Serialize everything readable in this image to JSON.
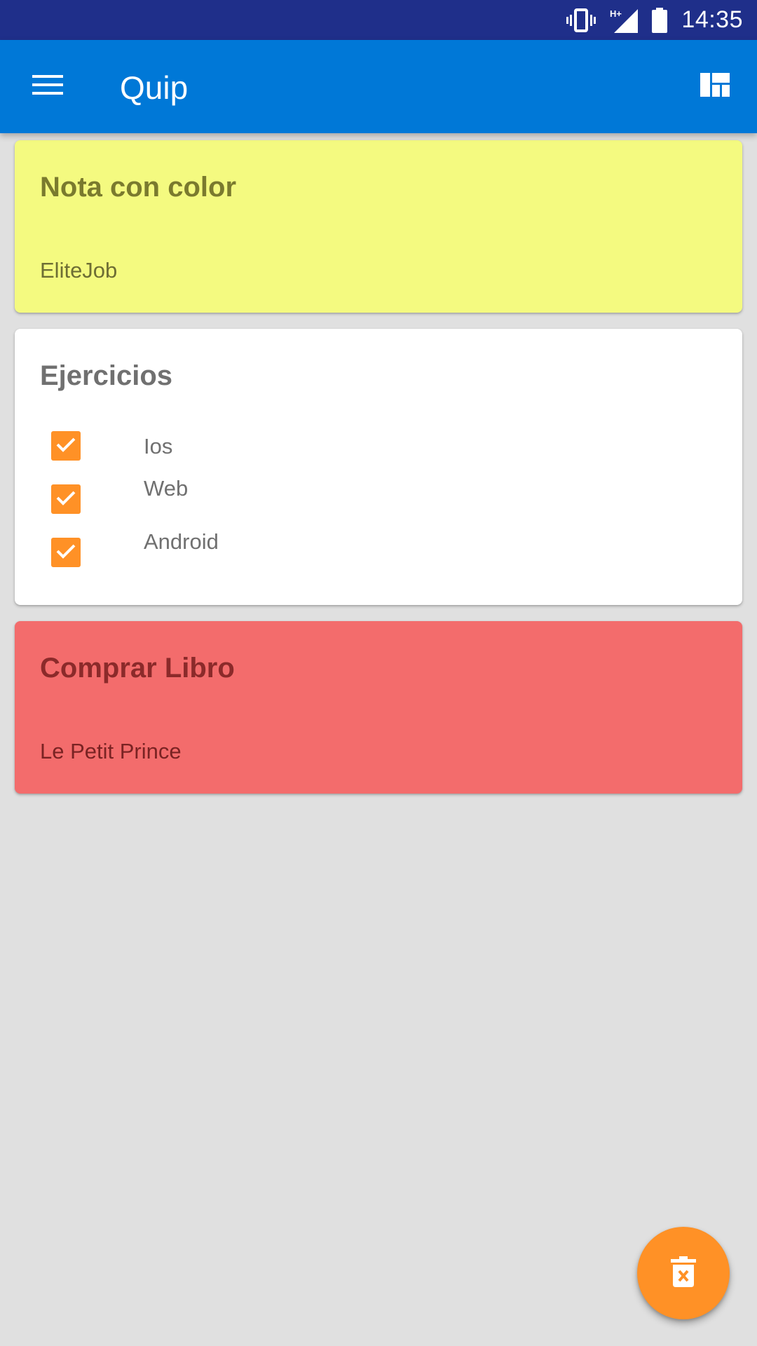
{
  "status_bar": {
    "time": "14:35",
    "icons": [
      "vibrate-icon",
      "signal-hplus-icon",
      "battery-icon"
    ],
    "network_label": "H+"
  },
  "app_bar": {
    "title": "Quip",
    "left_icon": "menu-icon",
    "right_icon": "layout-toggle-icon"
  },
  "notes": [
    {
      "title": "Nota con color",
      "body": "EliteJob",
      "color": "#f4fa80"
    },
    {
      "title": "Ejercicios",
      "color": "#ffffff",
      "checklist": [
        {
          "label": "Ios",
          "checked": true
        },
        {
          "label": "Web",
          "checked": true
        },
        {
          "label": "Android",
          "checked": true
        }
      ]
    },
    {
      "title": "Comprar Libro",
      "body": "Le Petit Prince",
      "color": "#f36c6c"
    }
  ],
  "fab": {
    "icon": "delete-icon",
    "color": "#ff9126"
  },
  "colors": {
    "status_bar": "#1f2f8a",
    "app_bar": "#0078d7",
    "background": "#e0e0e0",
    "accent": "#ff9126"
  }
}
